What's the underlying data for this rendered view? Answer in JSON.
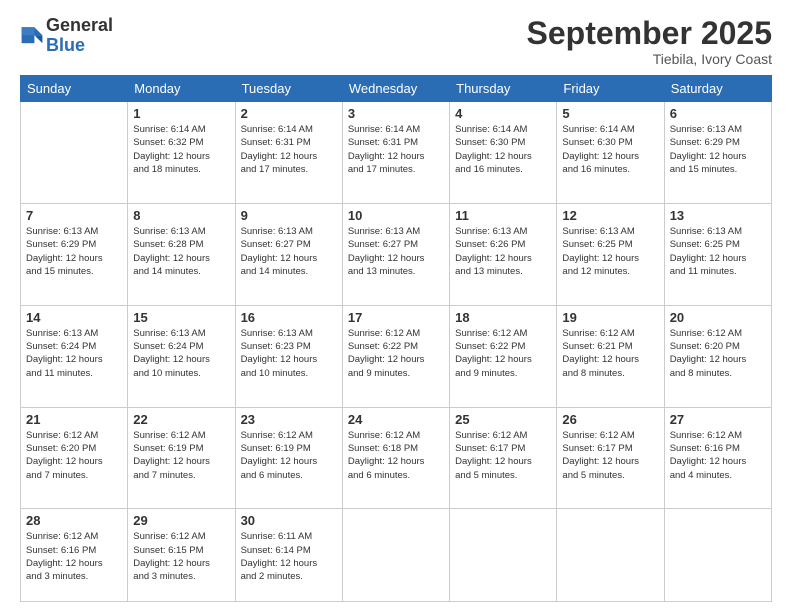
{
  "logo": {
    "line1": "General",
    "line2": "Blue"
  },
  "title": "September 2025",
  "location": "Tiebila, Ivory Coast",
  "days_header": [
    "Sunday",
    "Monday",
    "Tuesday",
    "Wednesday",
    "Thursday",
    "Friday",
    "Saturday"
  ],
  "weeks": [
    [
      {
        "num": "",
        "info": ""
      },
      {
        "num": "1",
        "info": "Sunrise: 6:14 AM\nSunset: 6:32 PM\nDaylight: 12 hours\nand 18 minutes."
      },
      {
        "num": "2",
        "info": "Sunrise: 6:14 AM\nSunset: 6:31 PM\nDaylight: 12 hours\nand 17 minutes."
      },
      {
        "num": "3",
        "info": "Sunrise: 6:14 AM\nSunset: 6:31 PM\nDaylight: 12 hours\nand 17 minutes."
      },
      {
        "num": "4",
        "info": "Sunrise: 6:14 AM\nSunset: 6:30 PM\nDaylight: 12 hours\nand 16 minutes."
      },
      {
        "num": "5",
        "info": "Sunrise: 6:14 AM\nSunset: 6:30 PM\nDaylight: 12 hours\nand 16 minutes."
      },
      {
        "num": "6",
        "info": "Sunrise: 6:13 AM\nSunset: 6:29 PM\nDaylight: 12 hours\nand 15 minutes."
      }
    ],
    [
      {
        "num": "7",
        "info": "Sunrise: 6:13 AM\nSunset: 6:29 PM\nDaylight: 12 hours\nand 15 minutes."
      },
      {
        "num": "8",
        "info": "Sunrise: 6:13 AM\nSunset: 6:28 PM\nDaylight: 12 hours\nand 14 minutes."
      },
      {
        "num": "9",
        "info": "Sunrise: 6:13 AM\nSunset: 6:27 PM\nDaylight: 12 hours\nand 14 minutes."
      },
      {
        "num": "10",
        "info": "Sunrise: 6:13 AM\nSunset: 6:27 PM\nDaylight: 12 hours\nand 13 minutes."
      },
      {
        "num": "11",
        "info": "Sunrise: 6:13 AM\nSunset: 6:26 PM\nDaylight: 12 hours\nand 13 minutes."
      },
      {
        "num": "12",
        "info": "Sunrise: 6:13 AM\nSunset: 6:25 PM\nDaylight: 12 hours\nand 12 minutes."
      },
      {
        "num": "13",
        "info": "Sunrise: 6:13 AM\nSunset: 6:25 PM\nDaylight: 12 hours\nand 11 minutes."
      }
    ],
    [
      {
        "num": "14",
        "info": "Sunrise: 6:13 AM\nSunset: 6:24 PM\nDaylight: 12 hours\nand 11 minutes."
      },
      {
        "num": "15",
        "info": "Sunrise: 6:13 AM\nSunset: 6:24 PM\nDaylight: 12 hours\nand 10 minutes."
      },
      {
        "num": "16",
        "info": "Sunrise: 6:13 AM\nSunset: 6:23 PM\nDaylight: 12 hours\nand 10 minutes."
      },
      {
        "num": "17",
        "info": "Sunrise: 6:12 AM\nSunset: 6:22 PM\nDaylight: 12 hours\nand 9 minutes."
      },
      {
        "num": "18",
        "info": "Sunrise: 6:12 AM\nSunset: 6:22 PM\nDaylight: 12 hours\nand 9 minutes."
      },
      {
        "num": "19",
        "info": "Sunrise: 6:12 AM\nSunset: 6:21 PM\nDaylight: 12 hours\nand 8 minutes."
      },
      {
        "num": "20",
        "info": "Sunrise: 6:12 AM\nSunset: 6:20 PM\nDaylight: 12 hours\nand 8 minutes."
      }
    ],
    [
      {
        "num": "21",
        "info": "Sunrise: 6:12 AM\nSunset: 6:20 PM\nDaylight: 12 hours\nand 7 minutes."
      },
      {
        "num": "22",
        "info": "Sunrise: 6:12 AM\nSunset: 6:19 PM\nDaylight: 12 hours\nand 7 minutes."
      },
      {
        "num": "23",
        "info": "Sunrise: 6:12 AM\nSunset: 6:19 PM\nDaylight: 12 hours\nand 6 minutes."
      },
      {
        "num": "24",
        "info": "Sunrise: 6:12 AM\nSunset: 6:18 PM\nDaylight: 12 hours\nand 6 minutes."
      },
      {
        "num": "25",
        "info": "Sunrise: 6:12 AM\nSunset: 6:17 PM\nDaylight: 12 hours\nand 5 minutes."
      },
      {
        "num": "26",
        "info": "Sunrise: 6:12 AM\nSunset: 6:17 PM\nDaylight: 12 hours\nand 5 minutes."
      },
      {
        "num": "27",
        "info": "Sunrise: 6:12 AM\nSunset: 6:16 PM\nDaylight: 12 hours\nand 4 minutes."
      }
    ],
    [
      {
        "num": "28",
        "info": "Sunrise: 6:12 AM\nSunset: 6:16 PM\nDaylight: 12 hours\nand 3 minutes."
      },
      {
        "num": "29",
        "info": "Sunrise: 6:12 AM\nSunset: 6:15 PM\nDaylight: 12 hours\nand 3 minutes."
      },
      {
        "num": "30",
        "info": "Sunrise: 6:11 AM\nSunset: 6:14 PM\nDaylight: 12 hours\nand 2 minutes."
      },
      {
        "num": "",
        "info": ""
      },
      {
        "num": "",
        "info": ""
      },
      {
        "num": "",
        "info": ""
      },
      {
        "num": "",
        "info": ""
      }
    ]
  ]
}
